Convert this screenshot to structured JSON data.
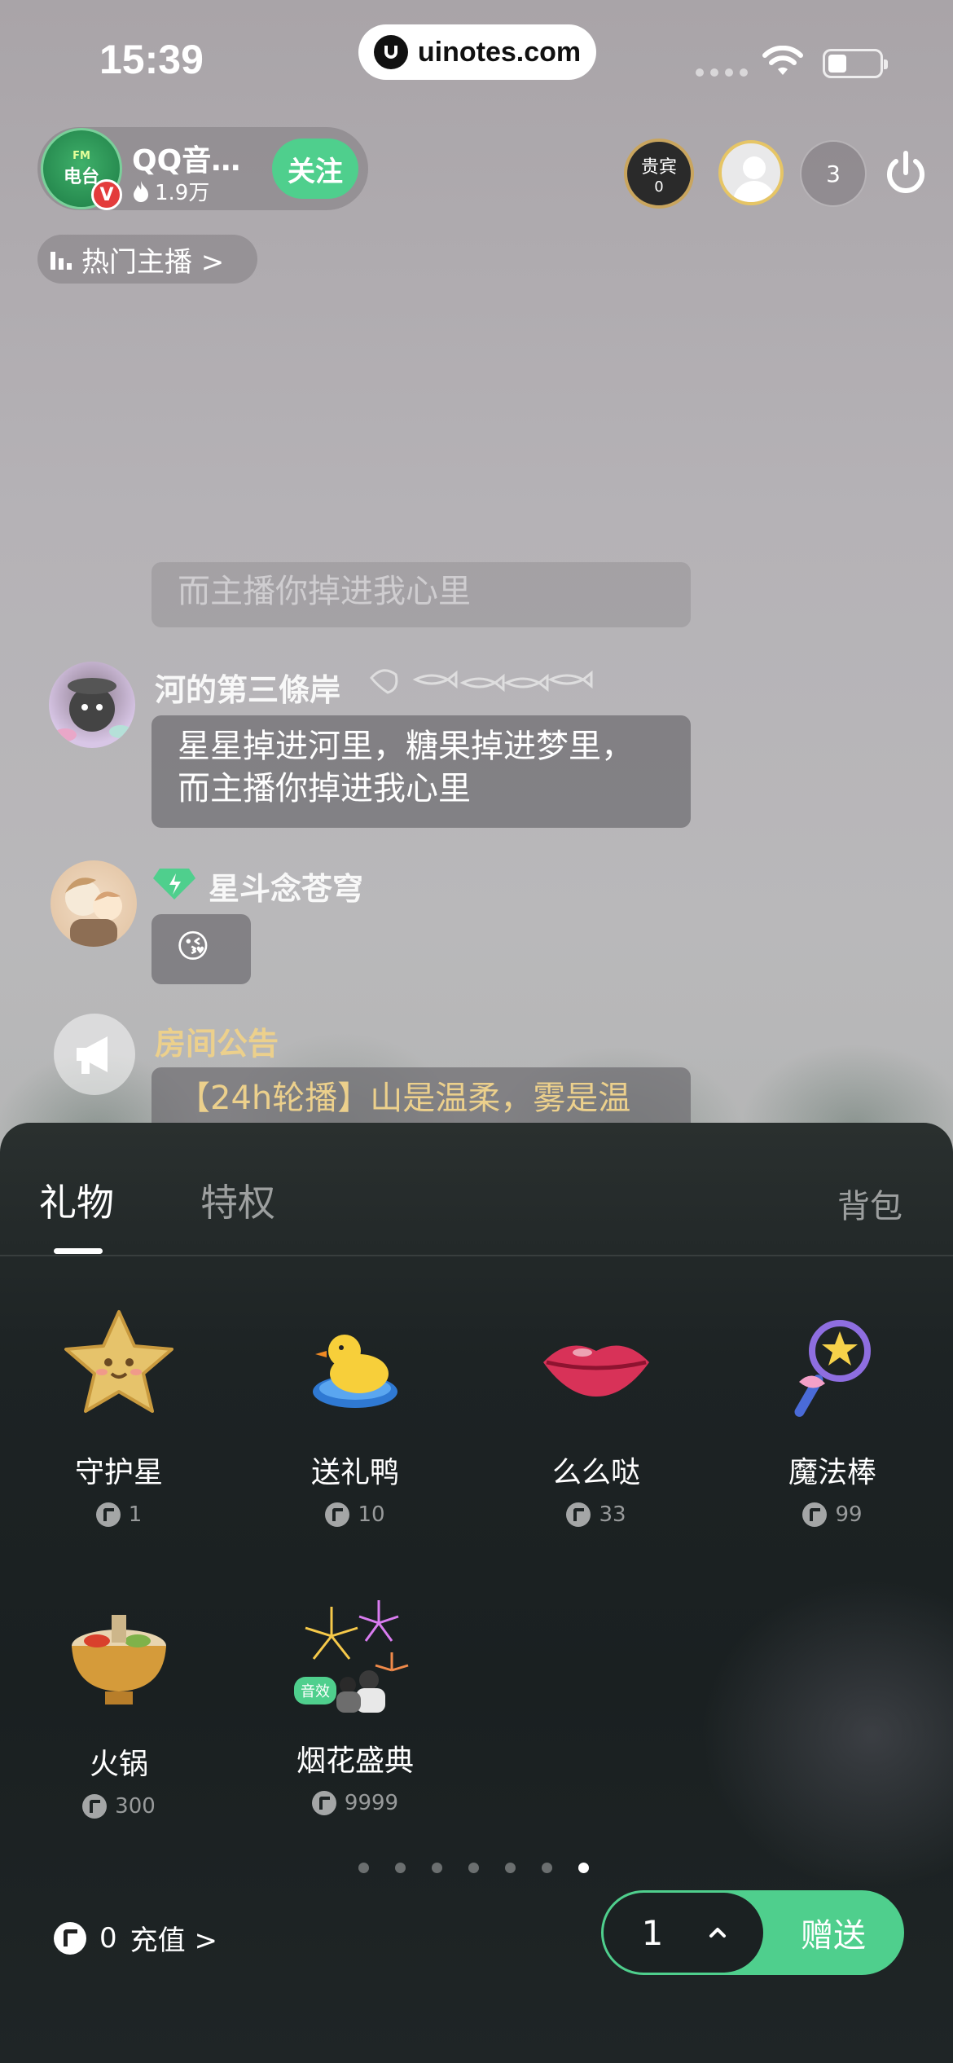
{
  "status_bar": {
    "time": "15:39",
    "url": "uinotes.com"
  },
  "host": {
    "avatar_line1": "FM",
    "avatar_line2": "电台",
    "verified": "V",
    "name": "QQ音…",
    "popularity": "1.9万",
    "follow_label": "关注"
  },
  "header_right": {
    "vip_label": "贵宾",
    "vip_count": "0",
    "viewer_count": "3"
  },
  "hot_anchors_label": "热门主播 >",
  "chat": {
    "faded_message": "而主播你掉进我心里",
    "messages": [
      {
        "user": "河的第三條岸",
        "line1": "星星掉进河里，糖果掉进梦里，",
        "line2": "而主播你掉进我心里"
      },
      {
        "user": "星斗念苍穹",
        "content": "😘"
      }
    ],
    "announcement": {
      "title": "房间公告",
      "content": "【24h轮播】山是温柔，雾是温"
    }
  },
  "gift_panel": {
    "tabs": [
      {
        "label": "礼物",
        "active": true
      },
      {
        "label": "特权",
        "active": false
      }
    ],
    "backpack_label": "背包",
    "gifts": [
      {
        "name": "守护星",
        "price": "1",
        "icon": "star-gift-icon"
      },
      {
        "name": "送礼鸭",
        "price": "10",
        "icon": "duck-gift-icon"
      },
      {
        "name": "么么哒",
        "price": "33",
        "icon": "lips-gift-icon"
      },
      {
        "name": "魔法棒",
        "price": "99",
        "icon": "wand-gift-icon"
      },
      {
        "name": "火锅",
        "price": "300",
        "icon": "hotpot-gift-icon"
      },
      {
        "name": "烟花盛典",
        "price": "9999",
        "icon": "fireworks-gift-icon",
        "tag": "音效"
      }
    ],
    "page_count": 7,
    "current_page": 7,
    "balance": "0",
    "recharge_label": "充值 >",
    "quantity": "1",
    "send_label": "赠送"
  },
  "colors": {
    "accent": "#4fcf8d",
    "announce": "#ecd08c",
    "panel_bg": "#1d2324"
  }
}
